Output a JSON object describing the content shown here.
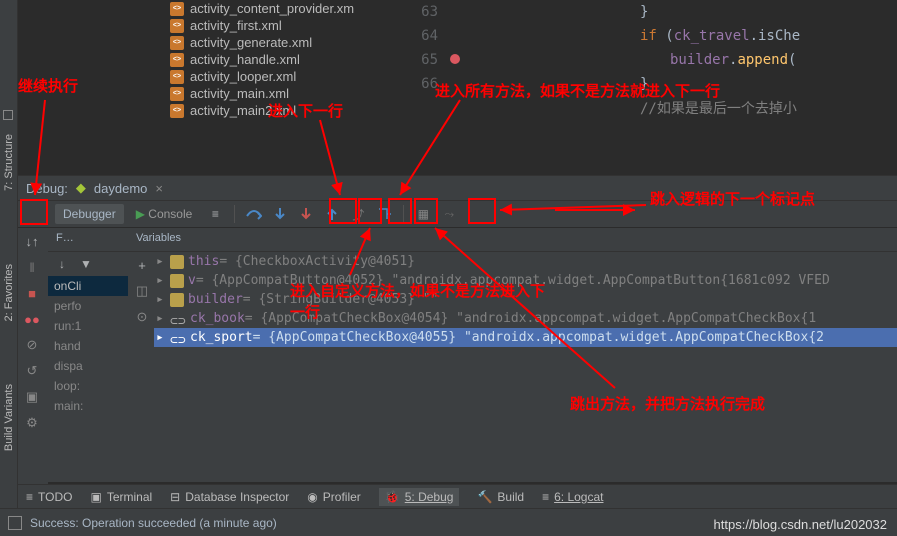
{
  "files": [
    "activity_content_provider.xm",
    "activity_first.xml",
    "activity_generate.xml",
    "activity_handle.xml",
    "activity_looper.xml",
    "activity_main.xml",
    "activity_main2.xml"
  ],
  "editor": {
    "lines": [
      {
        "num": "63",
        "brace": "}"
      },
      {
        "num": "64",
        "kw": "if",
        "code1": " (",
        "field": "ck_travel",
        "code2": ".isChe"
      },
      {
        "num": "65",
        "bp": true,
        "field": "builder",
        "code": ".",
        "method": "append",
        "paren": "("
      },
      {
        "num": "66",
        "brace": "}"
      },
      {
        "num": "",
        "comment": "//如果是最后一个去掉小"
      }
    ]
  },
  "debug": {
    "label": "Debug:",
    "config": "daydemo",
    "tab_debugger": "Debugger",
    "tab_console": "Console",
    "frames_header": "F…",
    "variables_header": "Variables"
  },
  "frames": [
    "onCli",
    "perfo",
    "run:1",
    "hand",
    "dispa",
    "loop:",
    "main:"
  ],
  "variables": [
    {
      "icon": "f",
      "name": "this",
      "value": " = {CheckboxActivity@4051}"
    },
    {
      "icon": "f",
      "name": "v",
      "value": " = {AppCompatButton@4052} \"androidx.appcompat.widget.AppCompatButton{1681c092 VFED"
    },
    {
      "icon": "f",
      "name": "builder",
      "value": " = {StringBuilder@4053} \"\""
    },
    {
      "icon": "l",
      "name": "ck_book",
      "value": " = {AppCompatCheckBox@4054} \"androidx.appcompat.widget.AppCompatCheckBox{1"
    },
    {
      "icon": "l",
      "name": "ck_sport",
      "value": " = {AppCompatCheckBox@4055} \"androidx.appcompat.widget.AppCompatCheckBox{2",
      "sel": true
    }
  ],
  "bottom": {
    "todo": "TODO",
    "terminal": "Terminal",
    "db": "Database Inspector",
    "profiler": "Profiler",
    "debug": "5: Debug",
    "build": "Build",
    "logcat": "6: Logcat"
  },
  "status": "Success: Operation succeeded (a minute ago)",
  "gutter": {
    "structure": "7: Structure",
    "favorites": "2: Favorites",
    "buildvar": "Build Variants"
  },
  "annotations": {
    "a1": "继续执行",
    "a2": "进入下一行",
    "a3": "进入所有方法，如果不是方法就进入下一行",
    "a4": "跳入逻辑的下一个标记点",
    "a5": "进入自定义方法，如果不是方法进入下一行",
    "a6": "跳出方法，并把方法执行完成"
  },
  "watermark": "https://blog.csdn.net/lu202032"
}
